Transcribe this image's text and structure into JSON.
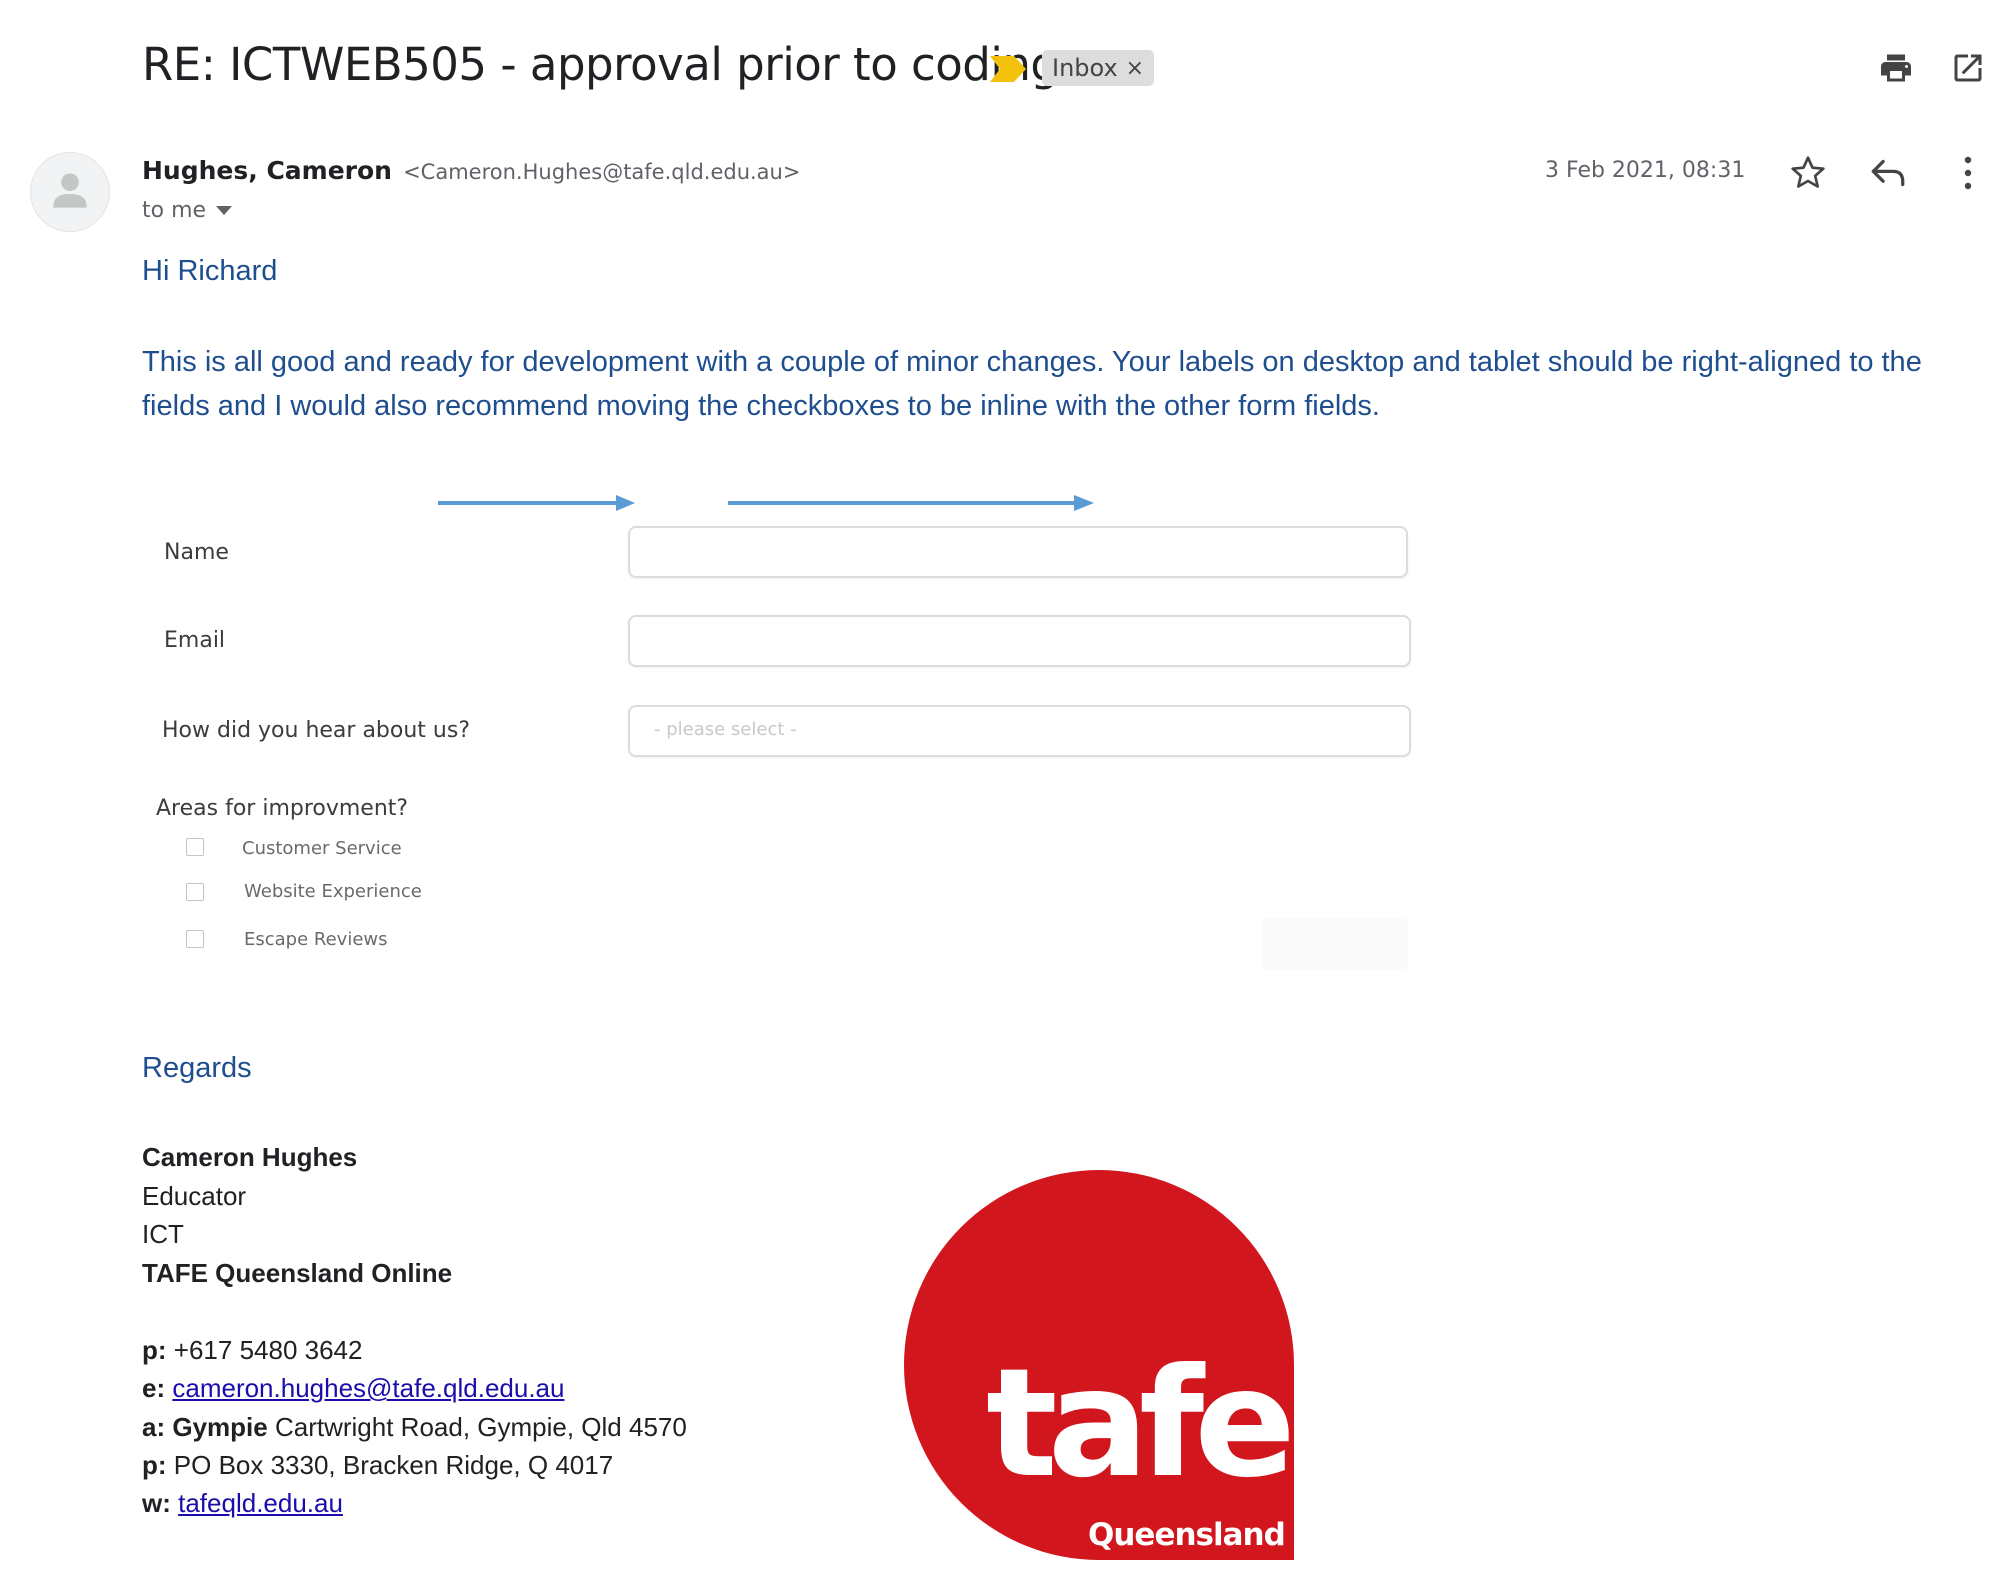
{
  "email": {
    "subject": "RE: ICTWEB505 - approval prior to coding",
    "label_chip": "Inbox",
    "label_chip_close": "×",
    "sender_name": "Hughes, Cameron",
    "sender_email": "<Cameron.Hughes@tafe.qld.edu.au>",
    "recipient": "to me",
    "timestamp": "3 Feb 2021, 08:31"
  },
  "body": {
    "greeting": "Hi Richard",
    "paragraph": "This is all good and ready for development with a couple of minor changes. Your labels on desktop and tablet should be right-aligned to the fields and I would also recommend moving the checkboxes to be inline with the other form fields.",
    "regards": "Regards"
  },
  "mockup": {
    "name_label": "Name",
    "email_label": "Email",
    "hear_label": "How did you hear about us?",
    "select_placeholder": "- please select -",
    "areas_label": "Areas for improvment?",
    "checkboxes": [
      "Customer Service",
      "Website Experience",
      "Escape Reviews"
    ]
  },
  "signature": {
    "name": "Cameron Hughes",
    "title": "Educator",
    "department": "ICT",
    "org": "TAFE Queensland Online",
    "phone_label": "p:",
    "phone": "+617 5480 3642",
    "email_label": "e:",
    "email": "cameron.hughes@tafe.qld.edu.au",
    "address_label": "a:",
    "address_campus": "Gympie",
    "address": "Cartwright Road, Gympie, Qld 4570",
    "postal_label": "p:",
    "postal": "PO Box 3330, Bracken Ridge, Q 4017",
    "web_label": "w:",
    "web": "tafeqld.edu.au"
  },
  "logo": {
    "word": "tafe",
    "sub": "Queensland"
  },
  "colors": {
    "body_text_blue": "#1f4e8f",
    "importance_yellow": "#f4c20d",
    "annotation_arrow": "#5b9bd5",
    "tafe_red": "#d2161e",
    "link_blue": "#1a0dab"
  },
  "icons": [
    "importance-marker-icon",
    "print-icon",
    "open-new-window-icon",
    "avatar-person-icon",
    "star-icon",
    "reply-icon",
    "more-vert-icon",
    "caret-down-icon"
  ]
}
